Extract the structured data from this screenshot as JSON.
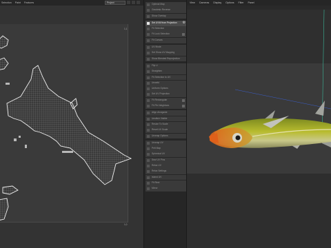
{
  "uv_editor": {
    "menu": [
      "Selection",
      "Paint",
      "Features"
    ],
    "mode_dropdown": "Project",
    "corner_top_right": "1,1",
    "corner_bottom_right": "1,0"
  },
  "tools": {
    "items": [
      {
        "label": "Optimal Map",
        "active": false
      },
      {
        "label": "Geodesic Reverse",
        "active": false
      },
      {
        "label": "Show Overlap",
        "active": false
      },
      {
        "label": "Set UVW from Projection",
        "active": true,
        "gear": true
      },
      {
        "label": "Fit Selection",
        "active": false
      },
      {
        "label": "Fit Lock Selection",
        "active": false,
        "dot": true
      },
      {
        "label": "Fit Canvas",
        "active": false
      },
      {
        "label": "UV Mode",
        "active": false
      },
      {
        "label": "Set Show UV Mapping",
        "active": false
      },
      {
        "label": "Show Blended Reprojection",
        "active": false
      },
      {
        "label": "Flip U",
        "active": false
      },
      {
        "label": "Straighten",
        "active": false
      },
      {
        "label": "Fit Selection to UV",
        "active": false
      },
      {
        "label": "Unweld",
        "active": false
      },
      {
        "label": "Uniform Options",
        "active": false
      },
      {
        "label": "Set UV Projection",
        "active": false
      },
      {
        "label": "Fit Rectangular",
        "active": false,
        "dot": true
      },
      {
        "label": "Fit Pin Neighbors",
        "active": false,
        "dot": true
      },
      {
        "label": "Align Alongside",
        "active": false
      },
      {
        "label": "Unstitch Visible",
        "active": false
      },
      {
        "label": "Resize To Scale",
        "active": false
      },
      {
        "label": "Reset UV Scale",
        "active": false
      },
      {
        "label": "Unwrap Options",
        "active": false
      },
      {
        "label": "Unwrap UV",
        "active": false
      },
      {
        "label": "Pelt Map",
        "active": false
      },
      {
        "label": "Spherical UV",
        "active": false
      },
      {
        "label": "Sew UV Pins",
        "active": false
      },
      {
        "label": "Relax UV",
        "active": false
      },
      {
        "label": "Relax Settings",
        "active": false
      },
      {
        "label": "Island UV",
        "active": false
      },
      {
        "label": "Fit Rect",
        "active": false
      },
      {
        "label": "Mirror",
        "active": false
      }
    ]
  },
  "viewport": {
    "menu": [
      "View",
      "Cameras",
      "Display",
      "Options",
      "Filter",
      "Panel"
    ],
    "colors": {
      "fish_body": "#a9b02c",
      "fish_belly": "#d8d4a0",
      "fish_head": "#e0601a",
      "axis_y": "#3bb89a",
      "axis_x": "#3a5fd0"
    }
  }
}
